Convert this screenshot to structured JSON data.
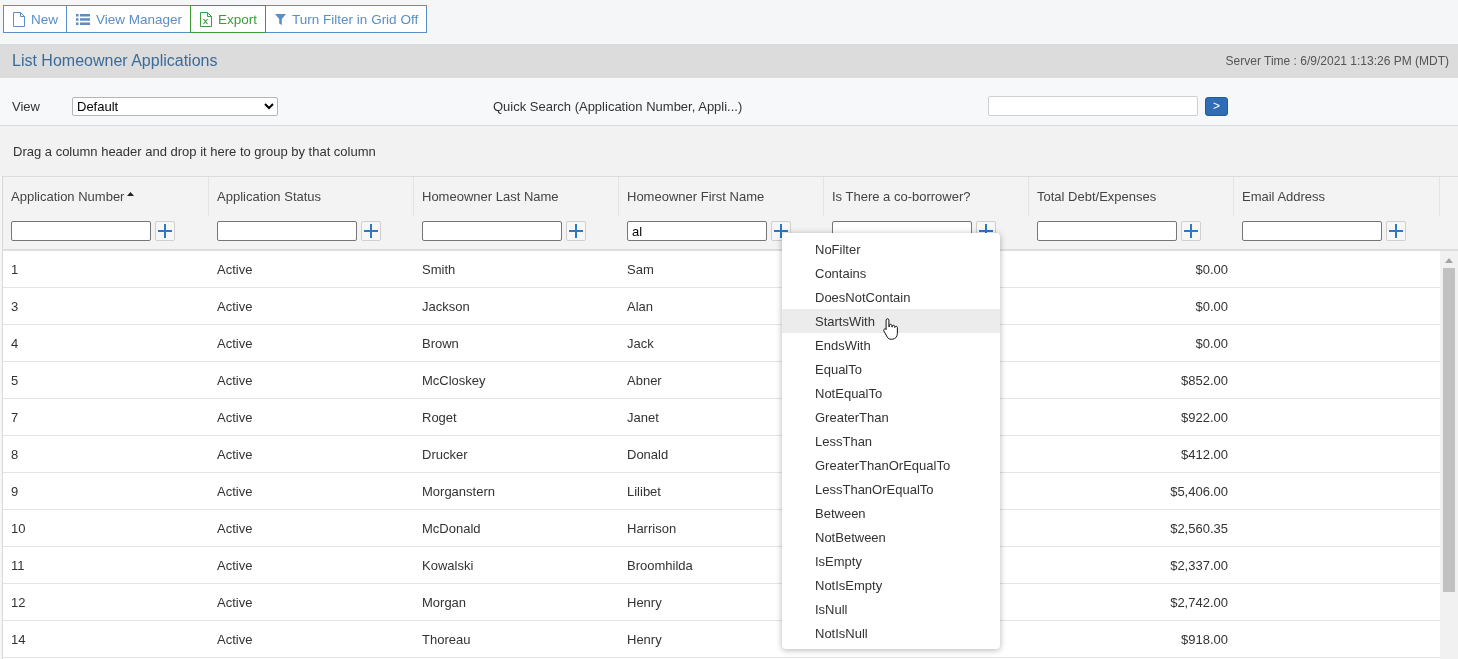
{
  "toolbar": {
    "buttons": [
      {
        "label": "New",
        "kind": "new"
      },
      {
        "label": "View Manager",
        "kind": "views"
      },
      {
        "label": "Export",
        "kind": "export"
      },
      {
        "label": "Turn Filter in Grid Off",
        "kind": "filter"
      }
    ]
  },
  "page_header": {
    "title": "List Homeowner Applications",
    "server_time": "Server Time : 6/9/2021 1:13:26 PM (MDT)"
  },
  "view_bar": {
    "view_label": "View",
    "view_select": "Default",
    "quick_search_label": "Quick Search (Application Number, Appli...)",
    "search_button": ">"
  },
  "group_panel": {
    "hint": "Drag a column header and drop it here to group by that column"
  },
  "grid": {
    "columns": [
      {
        "header": "Application Number",
        "sorted": true,
        "kind": "text"
      },
      {
        "header": "Application Status",
        "sorted": false,
        "kind": "text"
      },
      {
        "header": "Homeowner Last Name",
        "sorted": false,
        "kind": "text"
      },
      {
        "header": "Homeowner First Name",
        "sorted": false,
        "kind": "text",
        "filter_value": "al",
        "filter_menu": {
          "items": [
            {
              "label": "NoFilter",
              "selected": false
            },
            {
              "label": "Contains",
              "selected": false
            },
            {
              "label": "DoesNotContain",
              "selected": false
            },
            {
              "label": "StartsWith",
              "selected": true
            },
            {
              "label": "EndsWith",
              "selected": false
            },
            {
              "label": "EqualTo",
              "selected": false
            },
            {
              "label": "NotEqualTo",
              "selected": false
            },
            {
              "label": "GreaterThan",
              "selected": false
            },
            {
              "label": "LessThan",
              "selected": false
            },
            {
              "label": "GreaterThanOrEqualTo",
              "selected": false
            },
            {
              "label": "LessThanOrEqualTo",
              "selected": false
            },
            {
              "label": "Between",
              "selected": false
            },
            {
              "label": "NotBetween",
              "selected": false
            },
            {
              "label": "IsEmpty",
              "selected": false
            },
            {
              "label": "NotIsEmpty",
              "selected": false
            },
            {
              "label": "IsNull",
              "selected": false
            },
            {
              "label": "NotIsNull",
              "selected": false
            }
          ]
        }
      },
      {
        "header": "Is There a co-borrower?",
        "sorted": false,
        "kind": "text"
      },
      {
        "header": "Total Debt/Expenses",
        "sorted": false,
        "kind": "money"
      },
      {
        "header": "Email Address",
        "sorted": false,
        "kind": "text"
      }
    ],
    "rows": [
      {
        "application_number": "1",
        "application_status": "Active",
        "homeowner_last_name": "Smith",
        "homeowner_first_name": "Sam",
        "total_debt_expenses": "$0.00"
      },
      {
        "application_number": "3",
        "application_status": "Active",
        "homeowner_last_name": "Jackson",
        "homeowner_first_name": "Alan",
        "total_debt_expenses": "$0.00"
      },
      {
        "application_number": "4",
        "application_status": "Active",
        "homeowner_last_name": "Brown",
        "homeowner_first_name": "Jack",
        "total_debt_expenses": "$0.00"
      },
      {
        "application_number": "5",
        "application_status": "Active",
        "homeowner_last_name": "McCloskey",
        "homeowner_first_name": "Abner",
        "total_debt_expenses": "$852.00"
      },
      {
        "application_number": "7",
        "application_status": "Active",
        "homeowner_last_name": "Roget",
        "homeowner_first_name": "Janet",
        "total_debt_expenses": "$922.00"
      },
      {
        "application_number": "8",
        "application_status": "Active",
        "homeowner_last_name": "Drucker",
        "homeowner_first_name": "Donald",
        "total_debt_expenses": "$412.00"
      },
      {
        "application_number": "9",
        "application_status": "Active",
        "homeowner_last_name": "Morganstern",
        "homeowner_first_name": "Lilibet",
        "total_debt_expenses": "$5,406.00"
      },
      {
        "application_number": "10",
        "application_status": "Active",
        "homeowner_last_name": "McDonald",
        "homeowner_first_name": "Harrison",
        "total_debt_expenses": "$2,560.35"
      },
      {
        "application_number": "11",
        "application_status": "Active",
        "homeowner_last_name": "Kowalski",
        "homeowner_first_name": "Broomhilda",
        "total_debt_expenses": "$2,337.00"
      },
      {
        "application_number": "12",
        "application_status": "Active",
        "homeowner_last_name": "Morgan",
        "homeowner_first_name": "Henry",
        "total_debt_expenses": "$2,742.00"
      },
      {
        "application_number": "14",
        "application_status": "Active",
        "homeowner_last_name": "Thoreau",
        "homeowner_first_name": "Henry",
        "total_debt_expenses": "$918.00"
      }
    ]
  }
}
